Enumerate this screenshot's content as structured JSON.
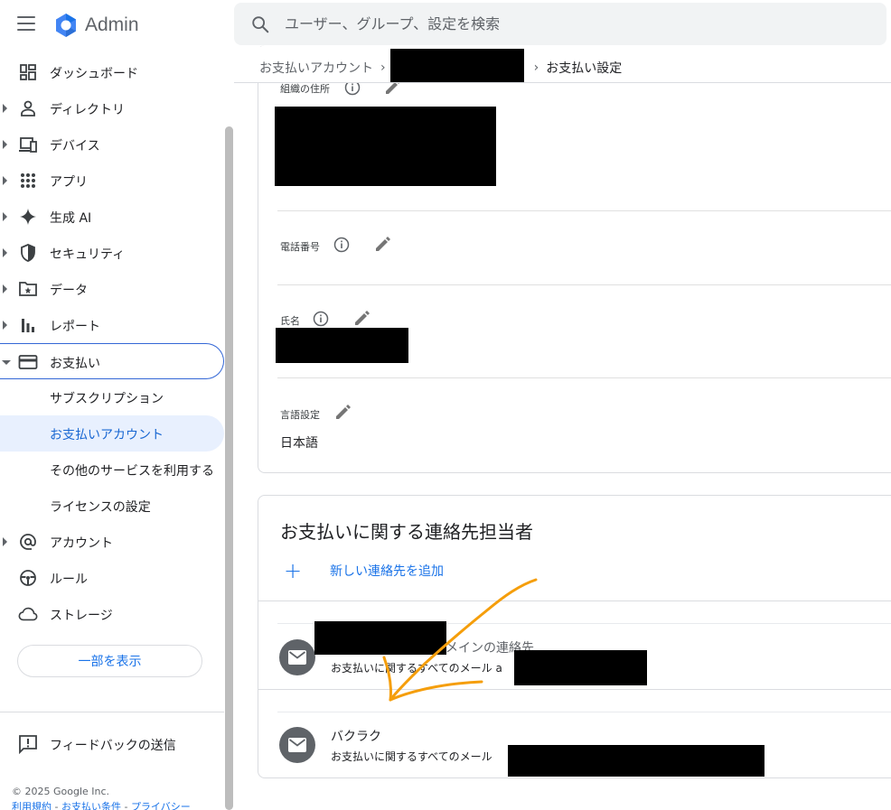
{
  "app": {
    "logo_text": "Admin",
    "menu_icon": "hamburger-menu-icon"
  },
  "search": {
    "placeholder": "ユーザー、グループ、設定を検索",
    "icon": "search-icon"
  },
  "sidebar": {
    "items": [
      {
        "label": "ダッシュボード",
        "icon": "dashboard-icon",
        "has_caret": false
      },
      {
        "label": "ディレクトリ",
        "icon": "person-icon",
        "has_caret": true
      },
      {
        "label": "デバイス",
        "icon": "devices-icon",
        "has_caret": true
      },
      {
        "label": "アプリ",
        "icon": "apps-grid-icon",
        "has_caret": true
      },
      {
        "label": "生成 AI",
        "icon": "sparkle-icon",
        "has_caret": true
      },
      {
        "label": "セキュリティ",
        "icon": "shield-icon",
        "has_caret": true
      },
      {
        "label": "データ",
        "icon": "folder-star-icon",
        "has_caret": true
      },
      {
        "label": "レポート",
        "icon": "bar-chart-icon",
        "has_caret": true
      },
      {
        "label": "お支払い",
        "icon": "credit-card-icon",
        "has_caret": true,
        "expanded": true,
        "selected": true
      }
    ],
    "billing_sub": [
      {
        "label": "サブスクリプション",
        "active": false
      },
      {
        "label": "お支払いアカウント",
        "active": true
      },
      {
        "label": "その他のサービスを利用する",
        "active": false
      },
      {
        "label": "ライセンスの設定",
        "active": false
      }
    ],
    "items_after": [
      {
        "label": "アカウント",
        "icon": "at-sign-icon",
        "has_caret": true
      },
      {
        "label": "ルール",
        "icon": "steering-wheel-icon",
        "has_caret": false
      },
      {
        "label": "ストレージ",
        "icon": "cloud-icon",
        "has_caret": false
      }
    ],
    "show_more_label": "一部を表示",
    "feedback_label": "フィードバックの送信",
    "copyright": "© 2025 Google Inc.",
    "footer_links": [
      "利用規約",
      "お支払い条件",
      "プライバシー"
    ]
  },
  "breadcrumb": {
    "items": [
      "お支払いアカウント",
      "お支払い設定"
    ]
  },
  "org_card": {
    "address_label": "組織の住所",
    "phone_label": "電話番号",
    "name_label": "氏名",
    "language_label": "言語設定",
    "language_value": "日本語"
  },
  "contacts_card": {
    "title": "お支払いに関する連絡先担当者",
    "add_label": "新しい連絡先を追加",
    "contacts": [
      {
        "tag": "メインの連絡先",
        "subtitle": "お支払いに関するすべてのメール",
        "sub_suffix": "a"
      },
      {
        "name": "バクラク",
        "subtitle": "お支払いに関するすべてのメール"
      }
    ]
  },
  "colors": {
    "accent": "#1a73e8",
    "selected_bg": "#e8f0fe",
    "annotation_arrow": "#f59e0b"
  }
}
